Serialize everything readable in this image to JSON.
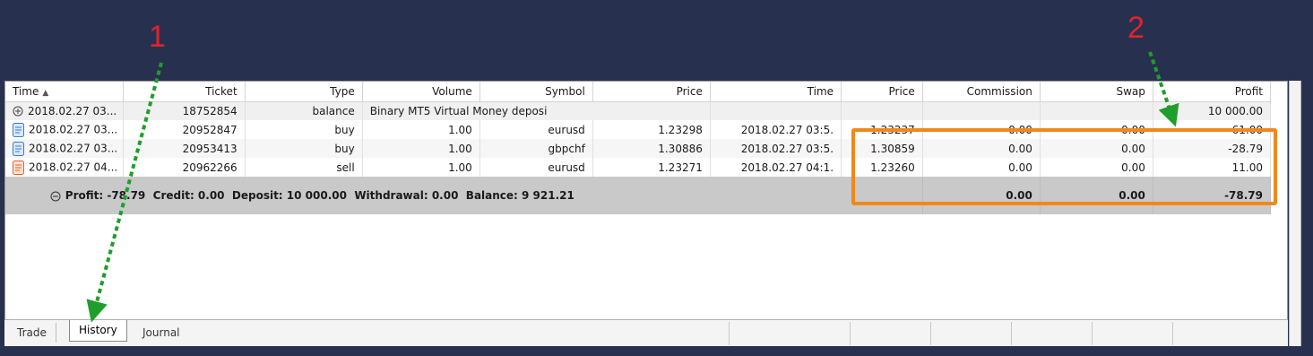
{
  "columns": [
    "Time",
    "Ticket",
    "Type",
    "Volume",
    "Symbol",
    "Price",
    "Time",
    "Price",
    "Commission",
    "Swap",
    "Profit"
  ],
  "rows": [
    {
      "time": "2018.02.27 03...",
      "ticket": "18752854",
      "type": "balance",
      "comment": "Binary MT5 Virtual Money deposi",
      "profit": "10 000.00"
    },
    {
      "time": "2018.02.27 03...",
      "ticket": "20952847",
      "type": "buy",
      "volume": "1.00",
      "symbol": "eurusd",
      "price_open": "1.23298",
      "time_close": "2018.02.27 03:5.",
      "price_close": "1.23237",
      "commission": "0.00",
      "swap": "0.00",
      "profit": "-61.00"
    },
    {
      "time": "2018.02.27 03...",
      "ticket": "20953413",
      "type": "buy",
      "volume": "1.00",
      "symbol": "gbpchf",
      "price_open": "1.30886",
      "time_close": "2018.02.27 03:5.",
      "price_close": "1.30859",
      "commission": "0.00",
      "swap": "0.00",
      "profit": "-28.79"
    },
    {
      "time": "2018.02.27 04...",
      "ticket": "20962266",
      "type": "sell",
      "volume": "1.00",
      "symbol": "eurusd",
      "price_open": "1.23271",
      "time_close": "2018.02.27 04:1.",
      "price_close": "1.23260",
      "commission": "0.00",
      "swap": "0.00",
      "profit": "11.00"
    }
  ],
  "summary": {
    "text": "Profit: -78.79  Credit: 0.00  Deposit: 10 000.00  Withdrawal: 0.00  Balance: 9 921.21",
    "commission": "0.00",
    "swap": "0.00",
    "profit": "-78.79"
  },
  "tabs": [
    "Trade",
    "History",
    "Journal"
  ],
  "annotations": [
    "1",
    "2"
  ],
  "colors": {
    "background": "#283050",
    "highlight": "#f0881a",
    "arrow": "#1e9e2a",
    "annotation_text": "#e0242b"
  },
  "icons": {
    "expand": "circle-plus-icon",
    "collapse": "circle-minus-icon",
    "buy": "blue-document-icon",
    "sell": "orange-document-icon"
  }
}
